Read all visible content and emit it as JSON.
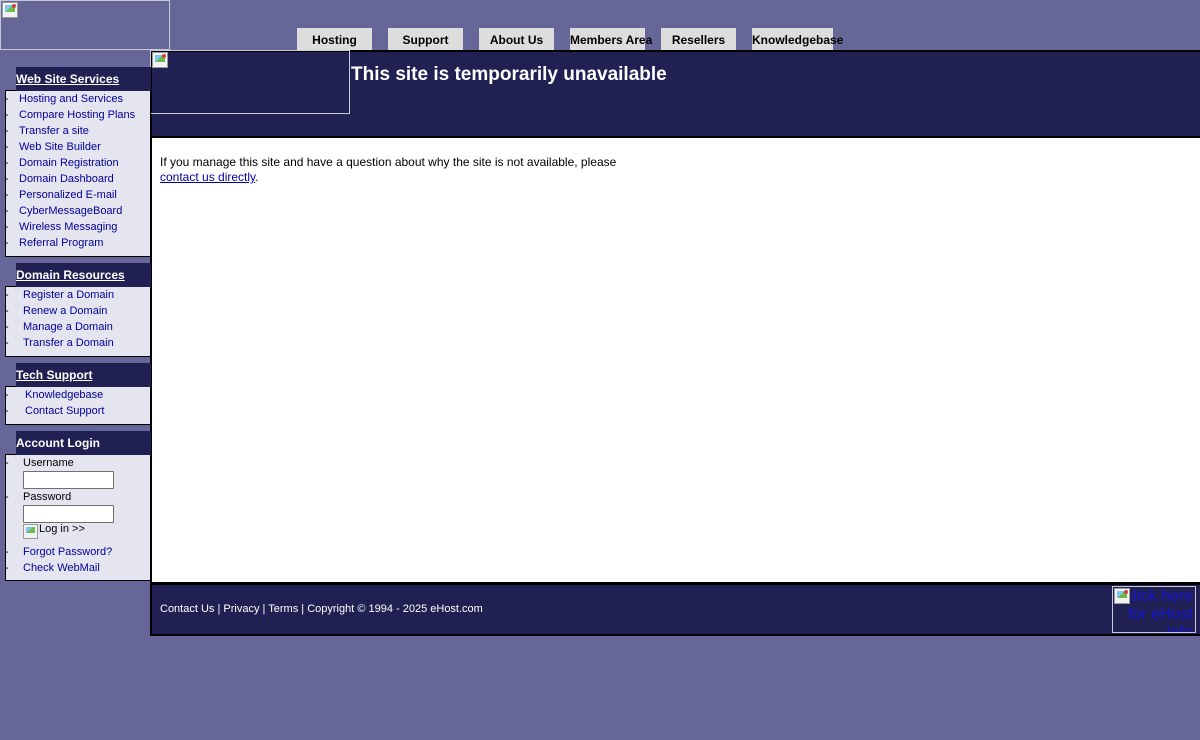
{
  "nav": {
    "tabs": [
      {
        "label": "Hosting"
      },
      {
        "label": "Support"
      },
      {
        "label": "About Us"
      },
      {
        "label": "Members Area"
      },
      {
        "label": "Resellers"
      },
      {
        "label": "Knowledgebase"
      }
    ]
  },
  "header": {
    "title": "This site is temporarily unavailable"
  },
  "content": {
    "message": "If you manage this site and have a question about why the site is not available, please",
    "contact_link": "contact us directly",
    "trailing": "."
  },
  "sidebar": {
    "web_services": {
      "heading": "Web Site Services",
      "items": [
        {
          "label": "Hosting and Services"
        },
        {
          "label": "Compare Hosting Plans"
        },
        {
          "label": "Transfer a site"
        },
        {
          "label": "Web Site Builder"
        },
        {
          "label": "Domain Registration"
        },
        {
          "label": "Domain Dashboard"
        },
        {
          "label": "Personalized E-mail"
        },
        {
          "label": "CyberMessageBoard"
        },
        {
          "label": "Wireless Messaging"
        },
        {
          "label": "Referral Program"
        }
      ]
    },
    "domain_resources": {
      "heading": "Domain Resources",
      "items": [
        {
          "label": "Register a Domain"
        },
        {
          "label": "Renew a Domain"
        },
        {
          "label": "Manage a Domain"
        },
        {
          "label": "Transfer a Domain"
        }
      ]
    },
    "tech_support": {
      "heading": "Tech Support",
      "items": [
        {
          "label": "Knowledgebase"
        },
        {
          "label": "Contact Support"
        }
      ]
    },
    "account_login": {
      "heading": "Account Login",
      "username_label": "Username",
      "password_label": "Password",
      "username_value": "",
      "password_value": "",
      "login_button": "Log in >>",
      "forgot_password": "Forgot Password?",
      "check_webmail": "Check WebMail"
    }
  },
  "footer": {
    "contact": "Contact Us",
    "privacy": "Privacy",
    "terms": "Terms",
    "copyright": "Copyright © 1994 - 2025 eHost.com",
    "separator": " | ",
    "badge_alt": "click here for eHost Info"
  }
}
